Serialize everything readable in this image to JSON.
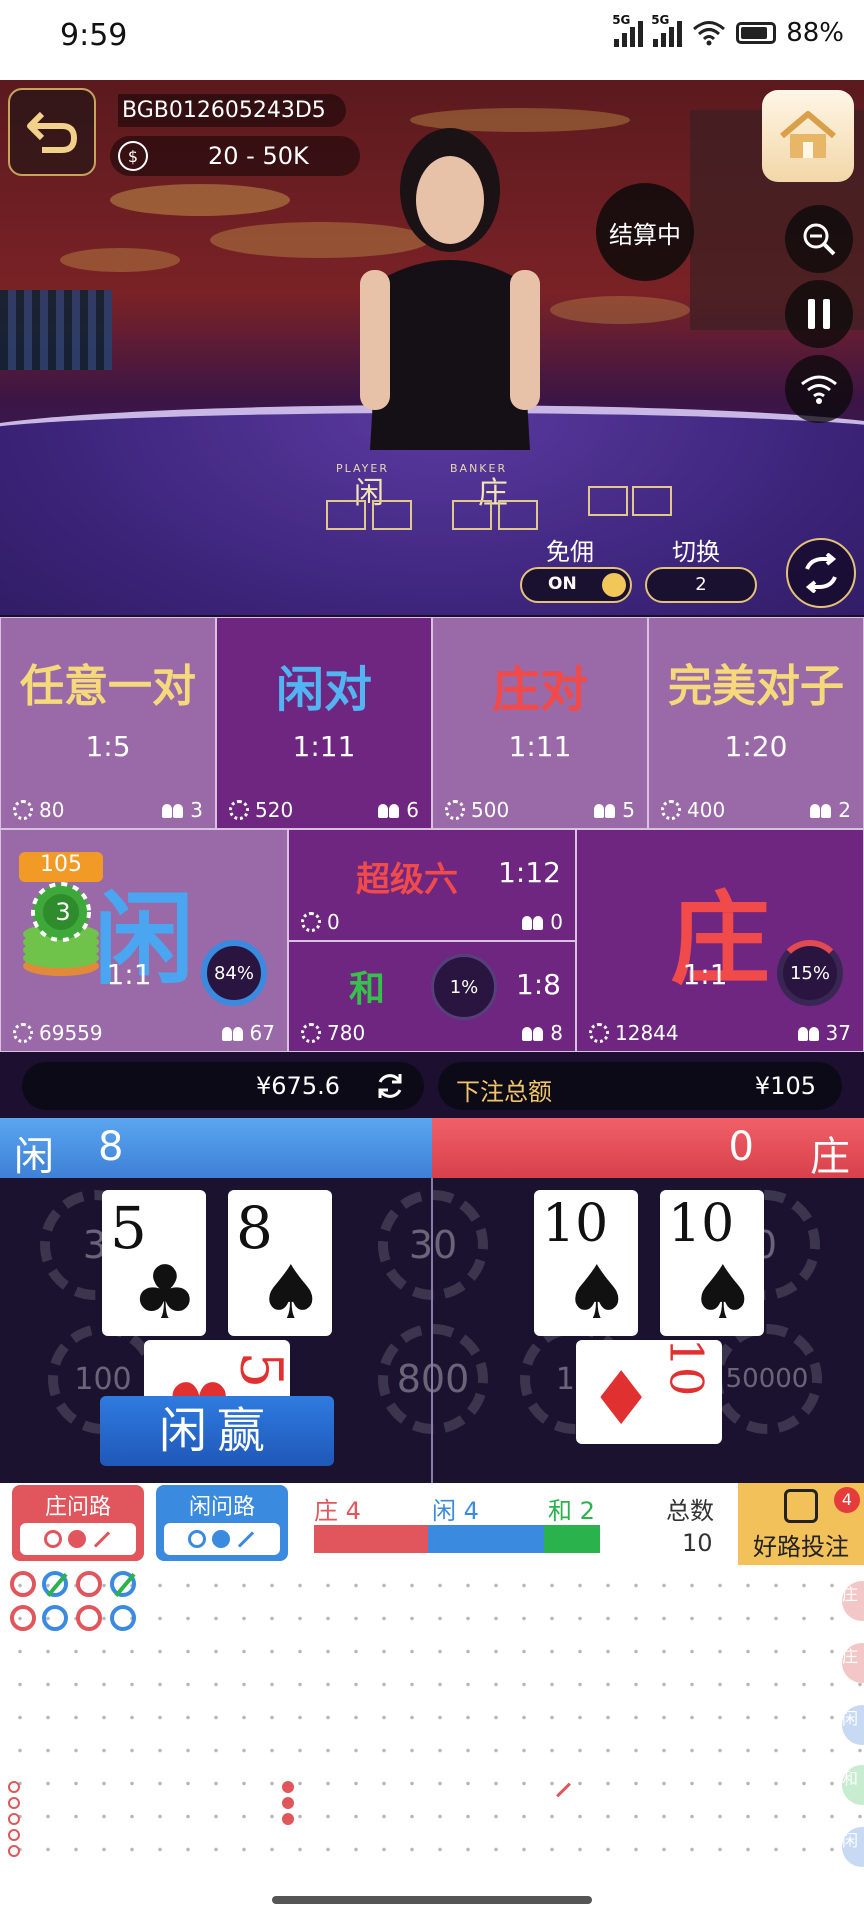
{
  "status_bar": {
    "time": "9:59",
    "net1": "5G",
    "net2": "5G",
    "battery": "88%"
  },
  "header": {
    "table_id": "BGB012605243D5",
    "limit": "20 - 50K",
    "settling": "结算中"
  },
  "table_labels": {
    "player_en": "PLAYER",
    "banker_en": "BANKER",
    "player_cn": "闲",
    "banker_cn": "庄"
  },
  "controls": {
    "commission_free": "免佣",
    "toggle_state": "ON",
    "switch_label": "切换",
    "switch_value": "2"
  },
  "bets": {
    "any_pair": {
      "title": "任意一对",
      "odds": "1:5",
      "amount": "80",
      "players": "3"
    },
    "player_pair": {
      "title": "闲对",
      "odds": "1:11",
      "amount": "520",
      "players": "6"
    },
    "banker_pair": {
      "title": "庄对",
      "odds": "1:11",
      "amount": "500",
      "players": "5"
    },
    "perfect_pair": {
      "title": "完美对子",
      "odds": "1:20",
      "amount": "400",
      "players": "2"
    },
    "player": {
      "title": "闲",
      "odds": "1:1",
      "amount": "69559",
      "players": "67",
      "percent": "84%",
      "my_bet": "105",
      "chip": "3"
    },
    "super_six": {
      "title": "超级六",
      "odds": "1:12",
      "amount": "0",
      "players": "0"
    },
    "tie": {
      "title": "和",
      "odds": "1:8",
      "amount": "780",
      "players": "8",
      "percent": "1%"
    },
    "banker": {
      "title": "庄",
      "odds": "1:1",
      "amount": "12844",
      "players": "37",
      "percent": "15%"
    }
  },
  "balance": {
    "amount": "¥675.6",
    "total_label": "下注总额",
    "total": "¥105"
  },
  "result": {
    "player_label": "闲",
    "player_score": "8",
    "banker_label": "庄",
    "banker_score": "0",
    "player_cards": [
      {
        "rank": "5",
        "suit": "♣"
      },
      {
        "rank": "8",
        "suit": "♠"
      }
    ],
    "banker_cards": [
      {
        "rank": "10",
        "suit": "♠"
      },
      {
        "rank": "10",
        "suit": "♠"
      }
    ],
    "player_third": {
      "rank": "5",
      "suit": "♥"
    },
    "banker_third": {
      "rank": "10",
      "suit": "♦"
    },
    "winner": "闲赢",
    "bg_chips": [
      "3",
      "100",
      "30",
      "800",
      "0",
      "10",
      "50000"
    ]
  },
  "roadmap": {
    "banker_ask": "庄问路",
    "player_ask": "闲问路",
    "banker_count": "庄 4",
    "player_count": "闲 4",
    "tie_count": "和 2",
    "total_label": "总数",
    "total": "10",
    "good_road": "好路投注",
    "good_road_badge": "4",
    "side_labels": [
      "庄",
      "庄",
      "闲",
      "和",
      "闲",
      "庄"
    ]
  },
  "colors": {
    "banker": "#e0565c",
    "player": "#3a8ae0",
    "tie": "#2ab34c",
    "gold": "#f2c15a",
    "purple": "#6e2680"
  }
}
